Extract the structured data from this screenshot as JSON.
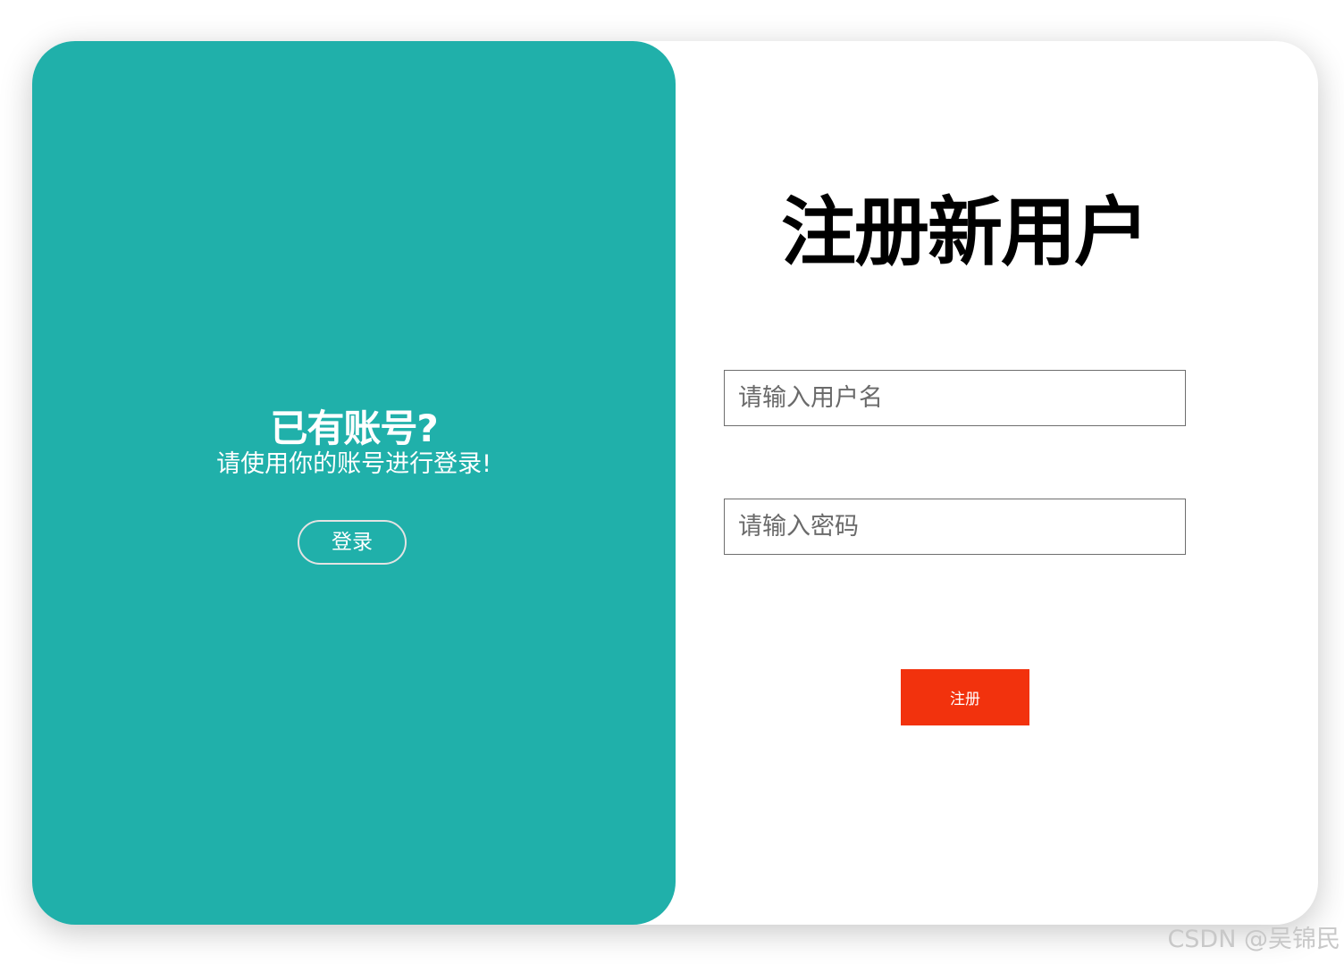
{
  "colors": {
    "panel_accent": "#20b0aa",
    "register_button": "#f2320d",
    "card_background": "#ffffff"
  },
  "login_panel": {
    "title": "已有账号?",
    "subtitle": "请使用你的账号进行登录!",
    "login_label": "登录"
  },
  "register_form": {
    "title": "注册新用户",
    "username_placeholder": "请输入用户名",
    "username_value": "",
    "password_placeholder": "请输入密码",
    "password_value": "",
    "register_label": "注册"
  },
  "watermark": "CSDN @吴锦民"
}
